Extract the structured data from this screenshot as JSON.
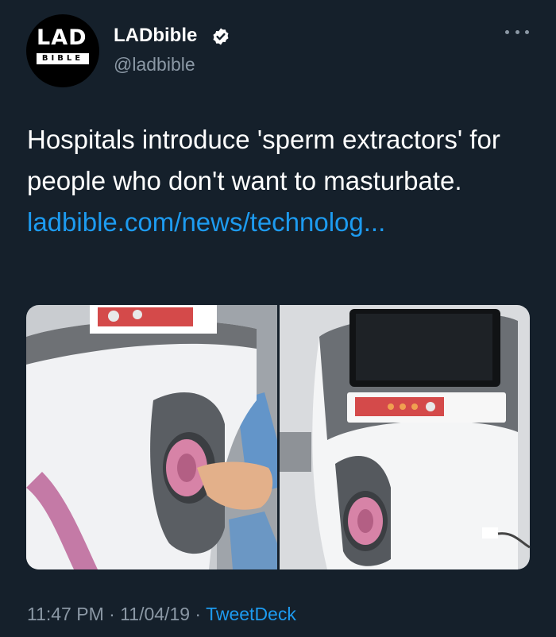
{
  "author": {
    "display_name": "LADbible",
    "handle": "@ladbible",
    "avatar_logo_top": "LAD",
    "avatar_logo_bottom": "BIBLE",
    "verified": true
  },
  "tweet": {
    "text": "Hospitals introduce 'sperm extractors' for people who don't want to masturbate.",
    "link_text": "ladbible.com/news/technolog..."
  },
  "media": {
    "photos": [
      {
        "icon": "photo-sperm-extractor-machine-left"
      },
      {
        "icon": "photo-sperm-extractor-machine-right"
      }
    ]
  },
  "meta": {
    "time": "11:47 PM",
    "separator": "·",
    "date": "11/04/19",
    "source": "TweetDeck"
  },
  "colors": {
    "background": "#15202b",
    "link": "#1d9bf0",
    "secondary_text": "#8b98a5"
  }
}
